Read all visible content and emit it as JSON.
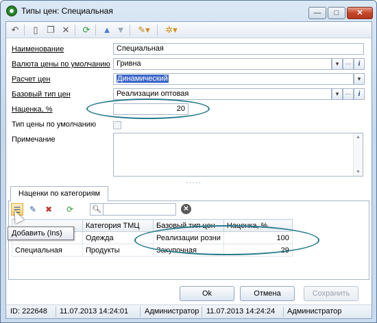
{
  "window": {
    "title": "Типы цен: Специальная",
    "close": "✕",
    "minimize": "—",
    "maximize": "□"
  },
  "form": {
    "name_label": "Наименование",
    "name_value": "Специальная",
    "currency_label": "Валюта цены по умолчанию",
    "currency_value": "Гривна",
    "calc_label": "Расчет цен",
    "calc_value": "Динамический",
    "base_type_label": "Базовый тип цен",
    "base_type_value": "Реализации оптовая",
    "markup_label": "Наценка, %",
    "markup_value": "20",
    "default_label": "Тип цены по умолчанию",
    "note_label": "Примечание",
    "ellipsis": "···",
    "info": "i",
    "dropdown": "▾"
  },
  "grip": "·····",
  "tab": {
    "label": "Наценки по категориям"
  },
  "grid": {
    "columns": [
      "",
      "Категория ТМЦ",
      "Базовый тип цен",
      "Наценка, %"
    ],
    "rows": [
      [
        "",
        "Одежда",
        "Реализации розни",
        "100"
      ],
      [
        "Специальная",
        "Продукты",
        "Закупочная",
        "29"
      ]
    ]
  },
  "tooltip": "Добавить (Ins)",
  "buttons": {
    "ok": "Ok",
    "cancel": "Отмена",
    "save": "Сохранить"
  },
  "status": {
    "id": "ID: 222648",
    "created_date": "11.07.2013 14:24:01",
    "created_by": "Администратор",
    "modified_date": "11.07.2013 14:24:24",
    "modified_by": "Администратор"
  },
  "colors": {
    "accent": "#3c66c8",
    "annotation": "#267a8a"
  }
}
